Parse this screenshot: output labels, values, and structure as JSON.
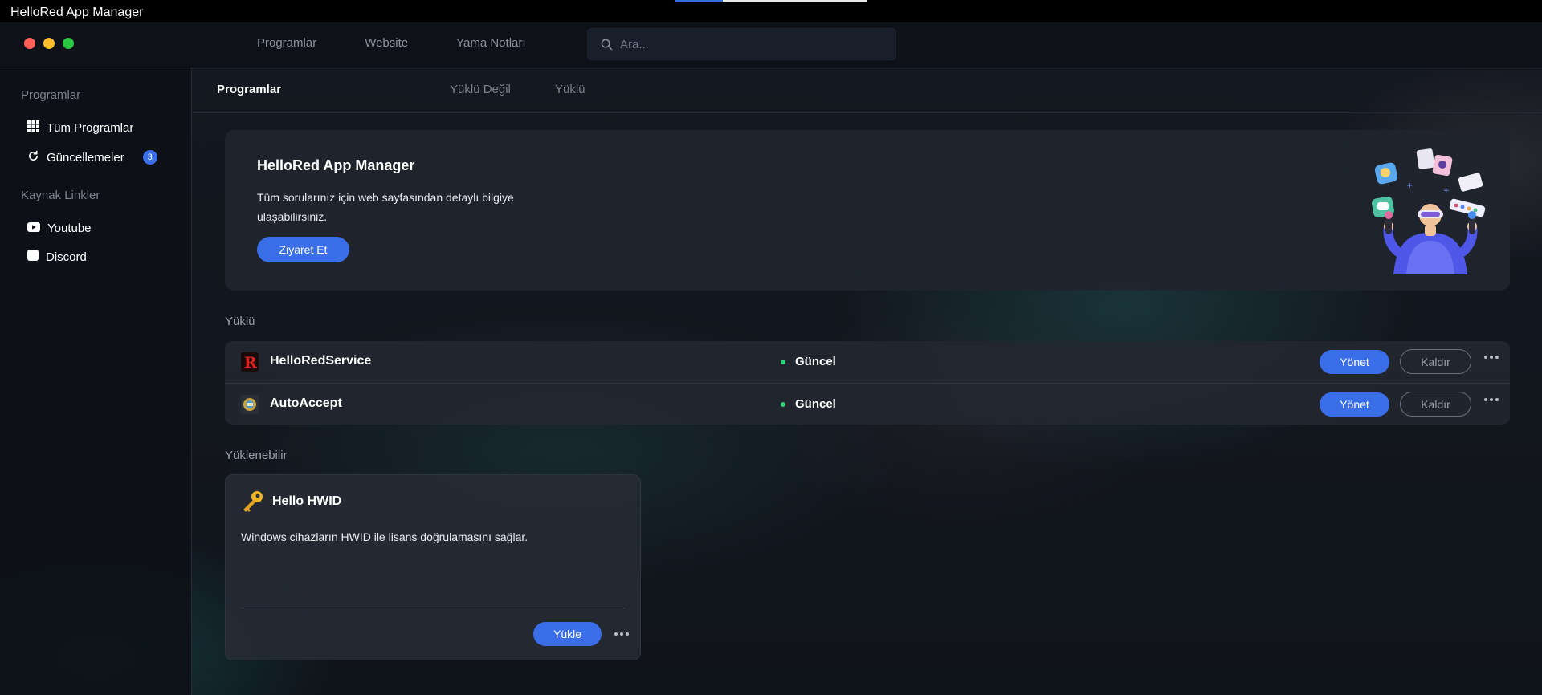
{
  "window": {
    "title": "HelloRed App Manager",
    "loading_progress": 0.25
  },
  "topnav": {
    "links": [
      "Programlar",
      "Website",
      "Yama Notları"
    ],
    "search": {
      "placeholder": "Ara...",
      "value": ""
    }
  },
  "sidebar": {
    "section1": "Programlar",
    "items": [
      {
        "label": "Tüm Programlar",
        "icon": "grid-icon"
      },
      {
        "label": "Güncellemeler",
        "icon": "refresh-icon",
        "badge": "3"
      }
    ],
    "section2": "Kaynak Linkler",
    "links": [
      {
        "label": "Youtube",
        "icon": "youtube-icon"
      },
      {
        "label": "Discord",
        "icon": "discord-icon"
      }
    ]
  },
  "tabs": [
    "Programlar",
    "Yüklü Değil",
    "Yüklü"
  ],
  "hero": {
    "title": "HelloRed App Manager",
    "text": "Tüm sorularınız için web sayfasından detaylı bilgiye ulaşabilirsiniz.",
    "button": "Ziyaret Et"
  },
  "installed": {
    "title": "Yüklü",
    "apps": [
      {
        "name": "HelloRedService",
        "status": "Güncel",
        "manage": "Yönet",
        "remove": "Kaldır",
        "icon": "hellored-app-icon"
      },
      {
        "name": "AutoAccept",
        "status": "Güncel",
        "manage": "Yönet",
        "remove": "Kaldır",
        "icon": "autoaccept-app-icon"
      }
    ]
  },
  "available": {
    "title": "Yüklenebilir",
    "apps": [
      {
        "name": "Hello HWID",
        "description": "Windows cihazların HWID ile lisans doğrulamasını sağlar.",
        "install": "Yükle",
        "icon": "key-icon"
      }
    ]
  },
  "colors": {
    "accent": "#3a6ee8",
    "status_ok": "#2fd07a",
    "close": "#ff5f57",
    "minimize": "#febc2e",
    "maximize": "#28c840"
  }
}
